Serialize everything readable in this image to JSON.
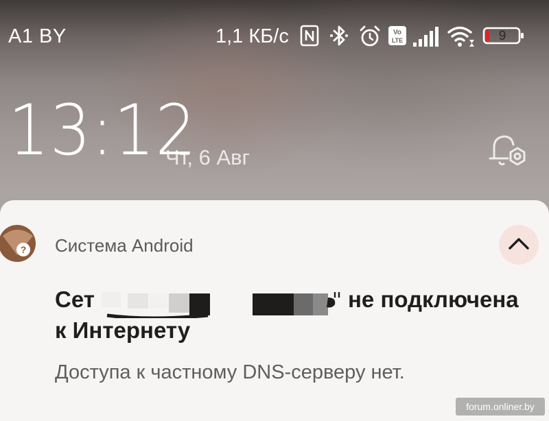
{
  "status_bar": {
    "carrier": "A1 BY",
    "network_speed": "1,1 КБ/с",
    "battery_level": "9",
    "icons": [
      "nfc-icon",
      "bluetooth-icon",
      "alarm-icon",
      "volte-icon",
      "signal-icon",
      "wifi-icon",
      "battery-icon"
    ]
  },
  "lockscreen": {
    "time": "13:12",
    "date": "Чт, 6 Авг"
  },
  "notification": {
    "app_name": "Система Android",
    "title_start": "Сет",
    "title_end": "не подключена",
    "title_line2": "к Интернету",
    "message": "Доступа к частному DNS-серверу нет.",
    "icons": [
      "wifi-question-icon",
      "chevron-up-icon"
    ]
  },
  "watermark": "forum.onliner.by",
  "colors": {
    "card_background": "#f7f5f4",
    "app_icon_background": "#8a5a3c",
    "collapse_button_background": "#f7e3de",
    "battery_low": "#d9262b"
  }
}
